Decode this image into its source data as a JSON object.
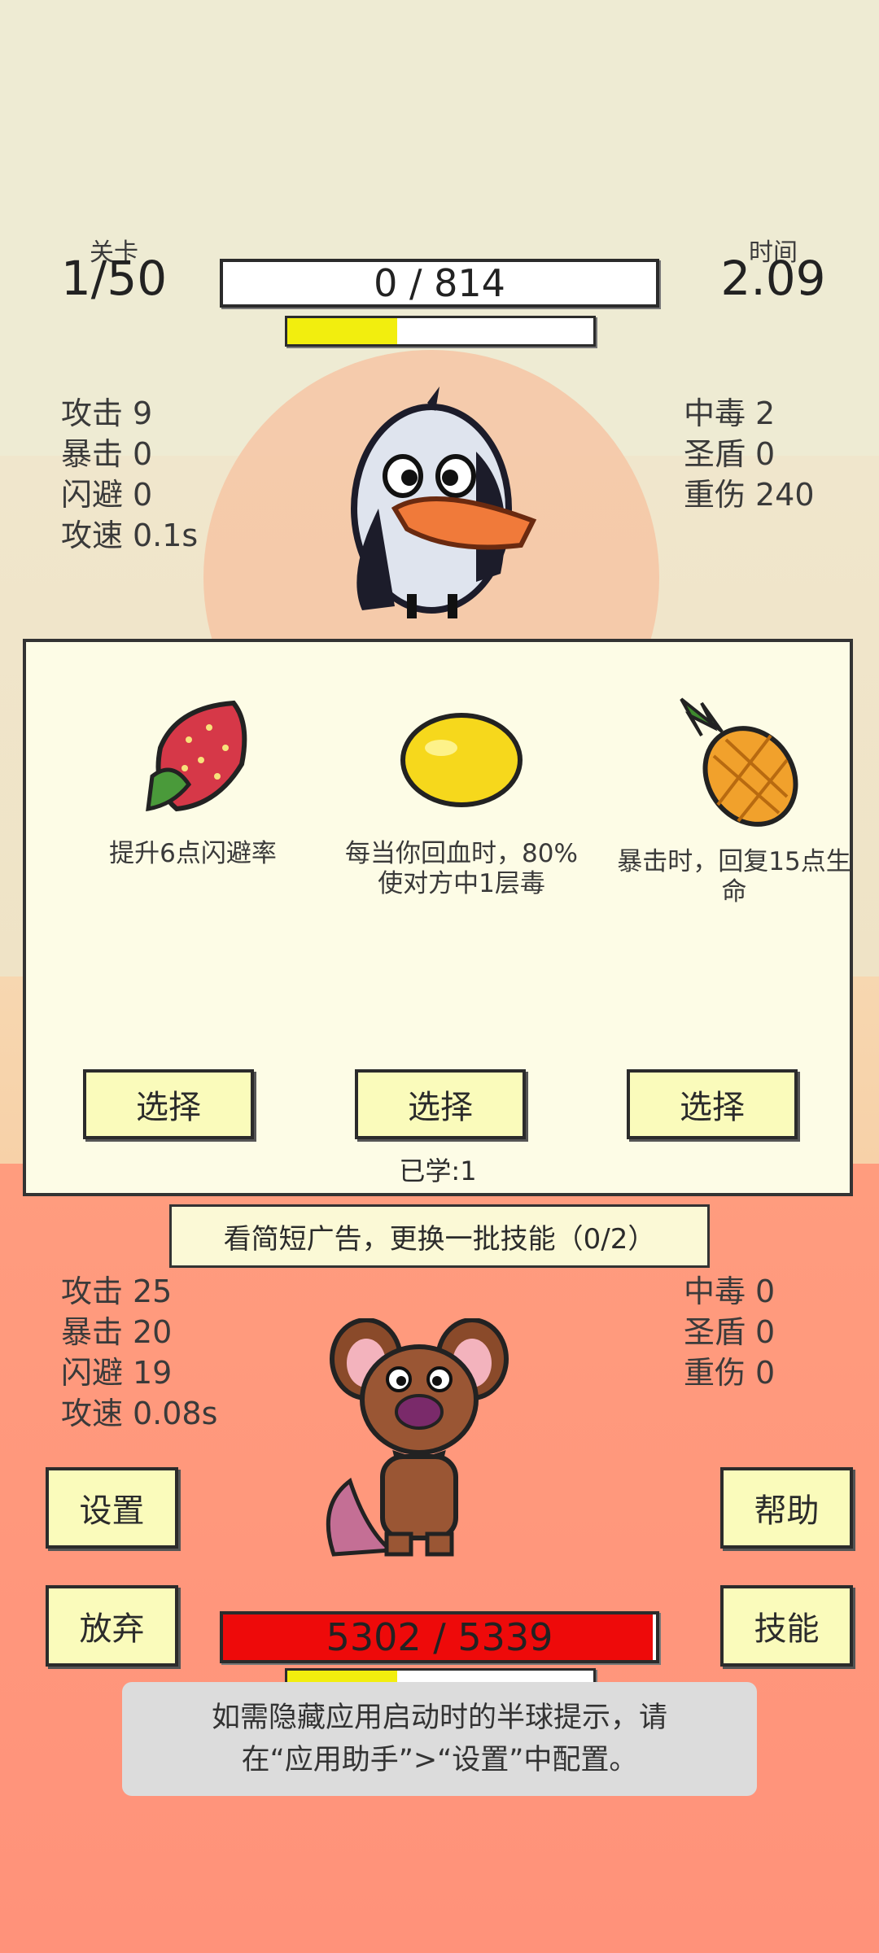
{
  "header": {
    "level_label": "关卡",
    "level_value": "1/50",
    "time_label": "时间",
    "time_value": "2.09"
  },
  "enemy": {
    "hp_text": "0 / 814",
    "hp_fraction": 0.0,
    "charge_fraction": 0.36,
    "stats_left": [
      {
        "name": "攻击",
        "value": "9"
      },
      {
        "name": "暴击",
        "value": "0"
      },
      {
        "name": "闪避",
        "value": "0"
      },
      {
        "name": "攻速",
        "value": "0.1s"
      }
    ],
    "stats_right": [
      {
        "name": "中毒",
        "value": "2"
      },
      {
        "name": "圣盾",
        "value": "0"
      },
      {
        "name": "重伤",
        "value": "240"
      }
    ],
    "sprite": "penguin-bird-icon"
  },
  "skill_panel": {
    "cards": [
      {
        "icon": "strawberry-icon",
        "desc": "提升6点闪避率",
        "button": "选择"
      },
      {
        "icon": "lemon-icon",
        "desc": "每当你回血时，80%使对方中1层毒",
        "button": "选择"
      },
      {
        "icon": "pineapple-icon",
        "desc": "暴击时，回复15点生命",
        "button": "选择"
      }
    ],
    "learned": "已学:1"
  },
  "ad_button": "看简短广告，更换一批技能（0/2）",
  "player": {
    "stats_left": [
      {
        "name": "攻击",
        "value": "25"
      },
      {
        "name": "暴击",
        "value": "20"
      },
      {
        "name": "闪避",
        "value": "19"
      },
      {
        "name": "攻速",
        "value": "0.08s"
      }
    ],
    "stats_right": [
      {
        "name": "中毒",
        "value": "0"
      },
      {
        "name": "圣盾",
        "value": "0"
      },
      {
        "name": "重伤",
        "value": "0"
      }
    ],
    "hp_text": "5302 / 5339",
    "hp_fraction": 0.993,
    "charge_fraction": 0.36,
    "sprite": "rat-icon"
  },
  "buttons": {
    "settings": "设置",
    "give_up": "放弃",
    "help": "帮助",
    "skills": "技能"
  },
  "toast": {
    "line1": "如需隐藏应用启动时的半球提示，请",
    "line2": "在“应用助手”>“设置”中配置。"
  },
  "colors": {
    "charge": "#f2ee0e",
    "hp_red": "#ee0a0a",
    "panel_bg": "#fdfce6",
    "button_bg": "#fafbbb"
  }
}
